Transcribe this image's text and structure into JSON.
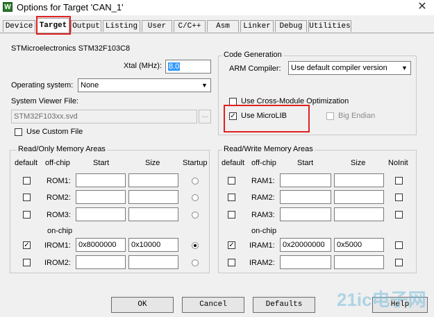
{
  "window": {
    "title": "Options for Target 'CAN_1'",
    "icon_letter": "W",
    "close_glyph": "✕"
  },
  "tabs": [
    "Device",
    "Target",
    "Output",
    "Listing",
    "User",
    "C/C++",
    "Asm",
    "Linker",
    "Debug",
    "Utilities"
  ],
  "device": {
    "name": "STMicroelectronics STM32F103C8",
    "xtal_label": "Xtal (MHz):",
    "xtal_value": "8.0",
    "os_label": "Operating system:",
    "os_value": "None",
    "svf_label": "System Viewer File:",
    "svf_value": "STM32F103xx.svd",
    "browse_label": "...",
    "custom_file_label": "Use Custom File"
  },
  "codegen": {
    "title": "Code Generation",
    "compiler_label": "ARM Compiler:",
    "compiler_value": "Use default compiler version",
    "cross_module_label": "Use Cross-Module Optimization",
    "microlib_label": "Use MicroLIB",
    "microlib_checked": true,
    "big_endian_label": "Big Endian"
  },
  "ro_memory": {
    "title": "Read/Only Memory Areas",
    "headers": {
      "default": "default",
      "offchip": "off-chip",
      "start": "Start",
      "size": "Size",
      "startup": "Startup"
    },
    "onchip_label": "on-chip",
    "rows": [
      {
        "label": "ROM1:",
        "start": "",
        "size": "",
        "default": false,
        "startup": false
      },
      {
        "label": "ROM2:",
        "start": "",
        "size": "",
        "default": false,
        "startup": false
      },
      {
        "label": "ROM3:",
        "start": "",
        "size": "",
        "default": false,
        "startup": false
      },
      {
        "label": "IROM1:",
        "start": "0x8000000",
        "size": "0x10000",
        "default": true,
        "startup": true
      },
      {
        "label": "IROM2:",
        "start": "",
        "size": "",
        "default": false,
        "startup": false
      }
    ]
  },
  "rw_memory": {
    "title": "Read/Write Memory Areas",
    "headers": {
      "default": "default",
      "offchip": "off-chip",
      "start": "Start",
      "size": "Size",
      "noinit": "NoInit"
    },
    "onchip_label": "on-chip",
    "rows": [
      {
        "label": "RAM1:",
        "start": "",
        "size": "",
        "default": false,
        "noinit": false
      },
      {
        "label": "RAM2:",
        "start": "",
        "size": "",
        "default": false,
        "noinit": false
      },
      {
        "label": "RAM3:",
        "start": "",
        "size": "",
        "default": false,
        "noinit": false
      },
      {
        "label": "IRAM1:",
        "start": "0x20000000",
        "size": "0x5000",
        "default": true,
        "noinit": false
      },
      {
        "label": "IRAM2:",
        "start": "",
        "size": "",
        "default": false,
        "noinit": false
      }
    ]
  },
  "buttons": {
    "ok": "OK",
    "cancel": "Cancel",
    "defaults": "Defaults",
    "help": "Help"
  },
  "watermark": "21ic电子网"
}
